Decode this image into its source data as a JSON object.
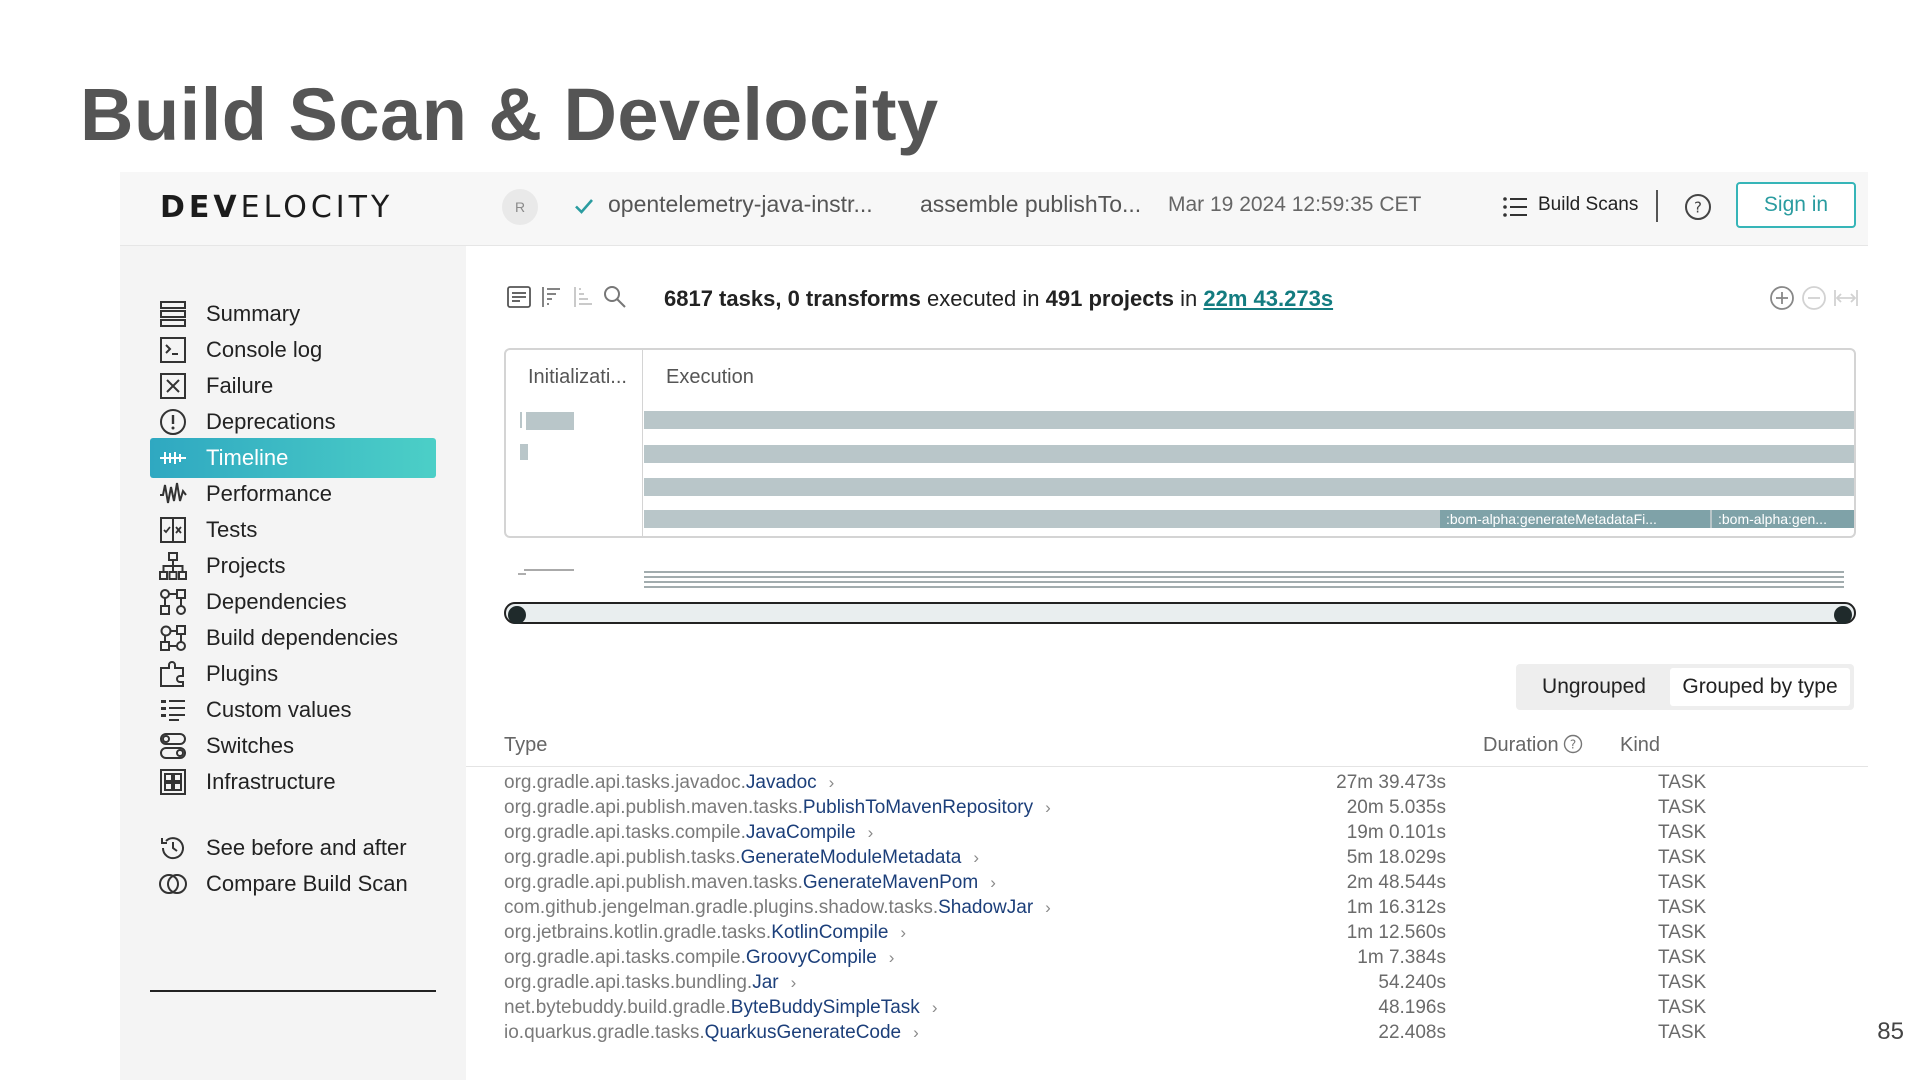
{
  "slide": {
    "title": "Build Scan & Develocity",
    "page_number": "85"
  },
  "header": {
    "logo_bold": "DEV",
    "logo_light": "ELOCITY",
    "avatar_initial": "R",
    "project": "opentelemetry-java-instr...",
    "tasks": "assemble publishTo...",
    "datetime": "Mar 19 2024 12:59:35 CET",
    "build_scans_label": "Build Scans",
    "sign_in_label": "Sign in"
  },
  "sidebar": {
    "items": [
      {
        "label": "Summary",
        "icon": "summary-icon"
      },
      {
        "label": "Console log",
        "icon": "console-icon"
      },
      {
        "label": "Failure",
        "icon": "failure-icon"
      },
      {
        "label": "Deprecations",
        "icon": "deprecations-icon"
      },
      {
        "label": "Timeline",
        "icon": "timeline-icon",
        "active": true
      },
      {
        "label": "Performance",
        "icon": "performance-icon"
      },
      {
        "label": "Tests",
        "icon": "tests-icon"
      },
      {
        "label": "Projects",
        "icon": "projects-icon"
      },
      {
        "label": "Dependencies",
        "icon": "dependencies-icon"
      },
      {
        "label": "Build dependencies",
        "icon": "build-dependencies-icon"
      },
      {
        "label": "Plugins",
        "icon": "plugins-icon"
      },
      {
        "label": "Custom values",
        "icon": "custom-values-icon"
      },
      {
        "label": "Switches",
        "icon": "switches-icon"
      },
      {
        "label": "Infrastructure",
        "icon": "infrastructure-icon"
      }
    ],
    "footer_items": [
      {
        "label": "See before and after",
        "icon": "history-icon"
      },
      {
        "label": "Compare Build Scan",
        "icon": "compare-icon"
      }
    ]
  },
  "summary": {
    "tasks": "6817 tasks,",
    "transforms": "0 transforms",
    "executed_in": "executed in",
    "projects": "491 projects",
    "in": "in",
    "duration": "22m 43.273s"
  },
  "timeline": {
    "phase_init": "Initializati...",
    "phase_exec": "Execution",
    "chip_1": ":bom-alpha:generateMetadataFi...",
    "chip_2": ":bom-alpha:gen..."
  },
  "grouping": {
    "ungrouped": "Ungrouped",
    "grouped_by_type": "Grouped by type",
    "selected": "Grouped by type"
  },
  "table": {
    "col_type": "Type",
    "col_duration": "Duration",
    "col_kind": "Kind",
    "rows": [
      {
        "pkg": "org.gradle.api.tasks.javadoc.",
        "cls": "Javadoc",
        "duration": "27m 39.473s",
        "kind": "TASK"
      },
      {
        "pkg": "org.gradle.api.publish.maven.tasks.",
        "cls": "PublishToMavenRepository",
        "duration": "20m 5.035s",
        "kind": "TASK"
      },
      {
        "pkg": "org.gradle.api.tasks.compile.",
        "cls": "JavaCompile",
        "duration": "19m 0.101s",
        "kind": "TASK"
      },
      {
        "pkg": "org.gradle.api.publish.tasks.",
        "cls": "GenerateModuleMetadata",
        "duration": "5m 18.029s",
        "kind": "TASK"
      },
      {
        "pkg": "org.gradle.api.publish.maven.tasks.",
        "cls": "GenerateMavenPom",
        "duration": "2m 48.544s",
        "kind": "TASK"
      },
      {
        "pkg": "com.github.jengelman.gradle.plugins.shadow.tasks.",
        "cls": "ShadowJar",
        "duration": "1m 16.312s",
        "kind": "TASK"
      },
      {
        "pkg": "org.jetbrains.kotlin.gradle.tasks.",
        "cls": "KotlinCompile",
        "duration": "1m 12.560s",
        "kind": "TASK"
      },
      {
        "pkg": "org.gradle.api.tasks.compile.",
        "cls": "GroovyCompile",
        "duration": "1m 7.384s",
        "kind": "TASK"
      },
      {
        "pkg": "org.gradle.api.tasks.bundling.",
        "cls": "Jar",
        "duration": "54.240s",
        "kind": "TASK"
      },
      {
        "pkg": "net.bytebuddy.build.gradle.",
        "cls": "ByteBuddySimpleTask",
        "duration": "48.196s",
        "kind": "TASK"
      },
      {
        "pkg": "io.quarkus.gradle.tasks.",
        "cls": "QuarkusGenerateCode",
        "duration": "22.408s",
        "kind": "TASK"
      }
    ]
  },
  "colors": {
    "accent": "#36b5b8",
    "active_gradient_start": "#2fa8c1",
    "active_gradient_end": "#4ccfc7",
    "timeline_bar": "#b9c6c9",
    "class_name": "#1c3f7a"
  }
}
